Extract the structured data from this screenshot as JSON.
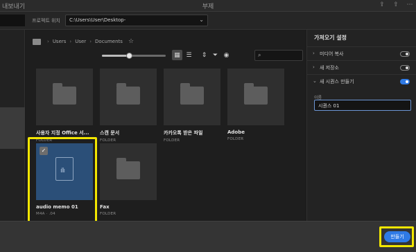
{
  "window": {
    "app_label": "내보내기",
    "title": "부제",
    "icons": [
      "share-icon",
      "export-icon",
      "more-icon"
    ]
  },
  "location": {
    "label": "프로젝트 위치",
    "path": "C:\\Users\\User\\Desktop-"
  },
  "browser": {
    "breadcrumb": [
      "Users",
      "User",
      "Documents"
    ],
    "zoom_level": 0.42,
    "search_placeholder": "",
    "items": [
      {
        "name": "사용자 지정 Office 서...",
        "type": "FOLDER"
      },
      {
        "name": "스캔 문서",
        "type": "FOLDER"
      },
      {
        "name": "카카오톡 받은 파일",
        "type": "FOLDER"
      },
      {
        "name": "Adobe",
        "type": "FOLDER"
      },
      {
        "name": "audio memo 01",
        "type": "M4A · .04",
        "selected": true
      },
      {
        "name": "Fax",
        "type": "FOLDER"
      }
    ]
  },
  "settings": {
    "title": "가져오기 설정",
    "rows": [
      {
        "label": "미디어 복사",
        "on": false
      },
      {
        "label": "새 저장소",
        "on": false
      },
      {
        "label": "새 시퀀스 만들기",
        "on": true
      }
    ],
    "field_label": "이름",
    "field_value": "시퀀스 01"
  },
  "footer": {
    "create_label": "만들기"
  },
  "colors": {
    "accent": "#2f7ae5",
    "highlight": "#f2e600",
    "selected_tile": "#2b4f78"
  }
}
